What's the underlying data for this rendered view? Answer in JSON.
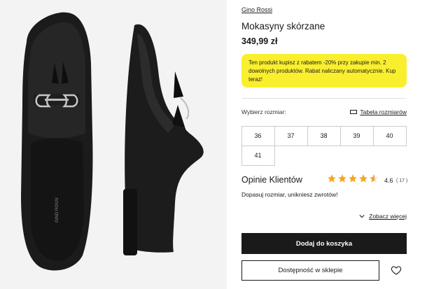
{
  "product": {
    "brand": "Gino Rossi",
    "title": "Mokasyny skórzane",
    "price": "349,99 zł",
    "promo_text": "Ten produkt kupisz z rabatem -20% przy zakupie min. 2 dowolnych produktów. Rabat naliczany automatycznie. Kup teraz!",
    "insole_brand": "GINO ROSSI"
  },
  "sizes": {
    "label": "Wybierz rozmiar:",
    "chart_link": "Tabela rozmiarów",
    "options": [
      "36",
      "37",
      "38",
      "39",
      "40",
      "41"
    ]
  },
  "reviews": {
    "title": "Opinie Klientów",
    "rating": "4.6",
    "count": "( 17 )",
    "stars_value": 4.6,
    "star_color": "#f5a623",
    "fit_text": "Dopasuj rozmiar, unikniesz zwrotów!",
    "see_more": "Zobacz więcej"
  },
  "actions": {
    "add_to_cart": "Dodaj do koszyka",
    "store_availability": "Dostępność w sklepie"
  },
  "icons": {
    "ruler": "ruler-icon",
    "chevron": "chevron-down-icon",
    "heart": "heart-icon"
  }
}
